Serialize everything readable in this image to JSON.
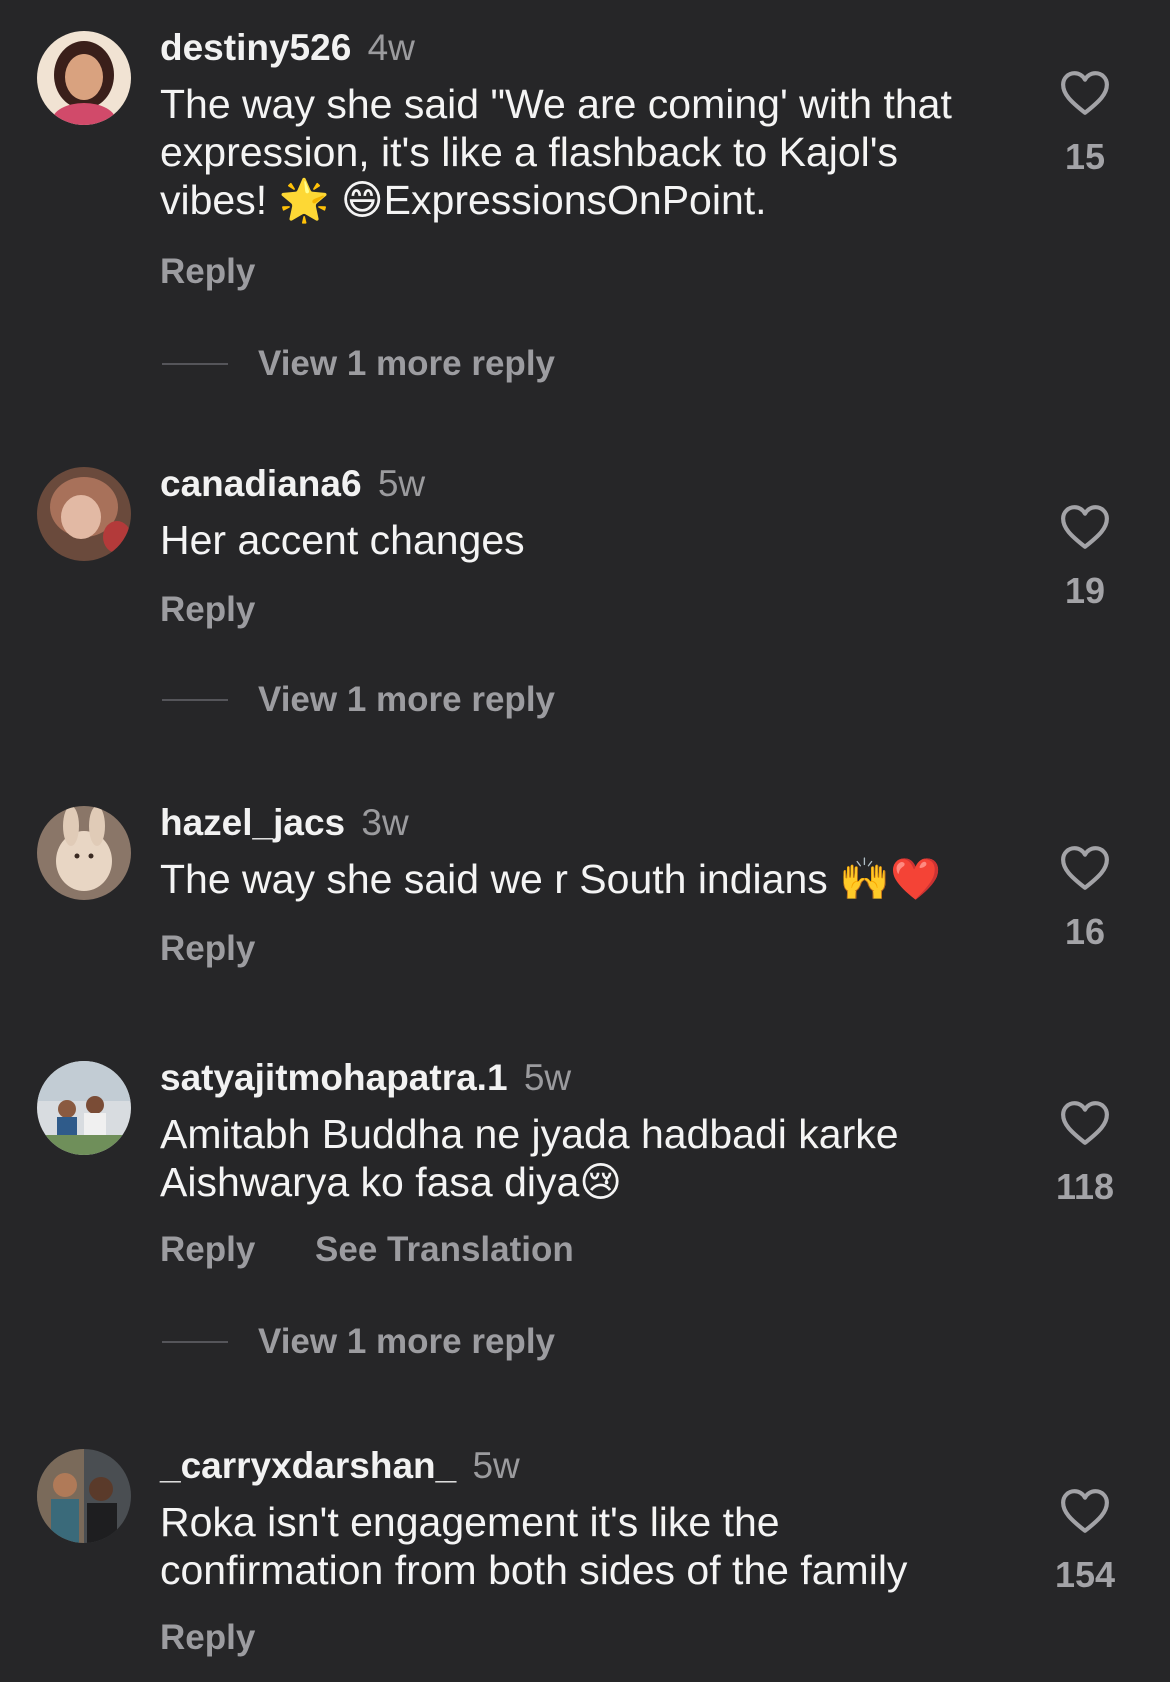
{
  "comments": [
    {
      "username": "destiny526",
      "time": "4w",
      "text": "The way she said \"We are coming' with that expression, it's like a flashback to Kajol's vibes! 🌟 😄ExpressionsOnPoint.",
      "likes": "15",
      "reply_label": "Reply",
      "view_more": "View 1 more reply"
    },
    {
      "username": "canadiana6",
      "time": "5w",
      "text": "Her accent changes",
      "likes": "19",
      "reply_label": "Reply",
      "view_more": "View 1 more reply"
    },
    {
      "username": "hazel_jacs",
      "time": "3w",
      "text": "The way she said we r South indians 🙌❤️",
      "likes": "16",
      "reply_label": "Reply"
    },
    {
      "username": "satyajitmohapatra.1",
      "time": "5w",
      "text": "Amitabh Buddha ne jyada hadbadi karke Aishwarya ko fasa diya😢",
      "likes": "118",
      "reply_label": "Reply",
      "translation_label": "See Translation",
      "view_more": "View 1 more reply"
    },
    {
      "username": "_carryxdarshan_",
      "time": "5w",
      "text": "Roka isn't engagement it's like the confirmation from both sides of the family",
      "likes": "154",
      "reply_label": "Reply"
    }
  ],
  "icons": {
    "like": "heart-outline-icon"
  },
  "colors": {
    "background": "#262628",
    "primary_text": "#f4f4f4",
    "secondary_text": "#9c9ca0"
  }
}
